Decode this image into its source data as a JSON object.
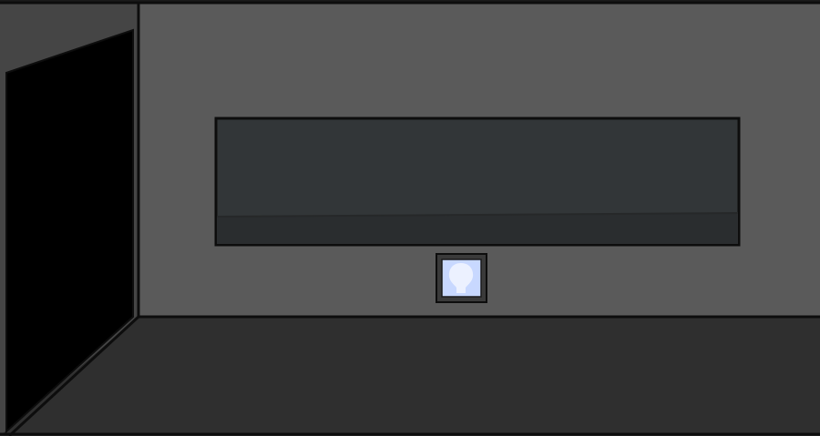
{
  "scene": {
    "name": "empty-room",
    "colors": {
      "back_wall": "#5a5a5a",
      "left_wall": "#454545",
      "floor": "#2f2f2f",
      "doorway": "#000000",
      "window_glass": "#323638",
      "window_sill": "#2a2d2f",
      "outline": "#0d0d0d",
      "light_panel_frame": "#3a3a3a",
      "light_panel_glow": "#c8d8ff",
      "light_bulb": "#eef2ff"
    },
    "objects": {
      "door": {
        "icon": "doorway-icon"
      },
      "window": {
        "icon": "window-icon"
      },
      "light_switch": {
        "icon": "lightbulb-icon"
      }
    }
  }
}
